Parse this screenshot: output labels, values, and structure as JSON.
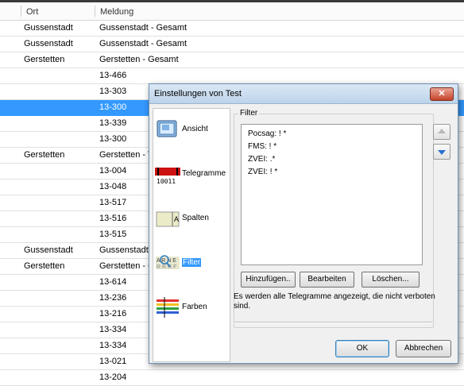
{
  "table": {
    "columns": {
      "ort": "Ort",
      "meldung": "Meldung"
    },
    "rows": [
      {
        "ort": "Gussenstadt",
        "meldung": "Gussenstadt - Gesamt"
      },
      {
        "ort": "Gussenstadt",
        "meldung": "Gussenstadt - Gesamt"
      },
      {
        "ort": "Gerstetten",
        "meldung": "Gerstetten - Gesamt"
      },
      {
        "ort": "",
        "meldung": "13-466"
      },
      {
        "ort": "",
        "meldung": "13-303"
      },
      {
        "ort": "",
        "meldung": "13-300",
        "selected": true
      },
      {
        "ort": "",
        "meldung": "13-339"
      },
      {
        "ort": "",
        "meldung": "13-300"
      },
      {
        "ort": "Gerstetten",
        "meldung": "Gerstetten - T"
      },
      {
        "ort": "",
        "meldung": "13-004"
      },
      {
        "ort": "",
        "meldung": "13-048"
      },
      {
        "ort": "",
        "meldung": "13-517"
      },
      {
        "ort": "",
        "meldung": "13-516"
      },
      {
        "ort": "",
        "meldung": "13-515"
      },
      {
        "ort": "Gussenstadt",
        "meldung": "Gussenstadt -"
      },
      {
        "ort": "Gerstetten",
        "meldung": "Gerstetten - G"
      },
      {
        "ort": "",
        "meldung": "13-614"
      },
      {
        "ort": "",
        "meldung": "13-236"
      },
      {
        "ort": "",
        "meldung": "13-216"
      },
      {
        "ort": "",
        "meldung": "13-334"
      },
      {
        "ort": "",
        "meldung": "13-334"
      },
      {
        "ort": "",
        "meldung": "13-021"
      },
      {
        "ort": "",
        "meldung": "13-204"
      }
    ]
  },
  "dialog": {
    "title": "Einstellungen von Test",
    "close_label": "✕",
    "nav": [
      {
        "label": "Ansicht",
        "icon": "monitor-icon"
      },
      {
        "label": "Telegramme",
        "icon": "telegram-icon"
      },
      {
        "label": "Spalten",
        "icon": "columns-icon"
      },
      {
        "label": "Filter",
        "icon": "filter-icon",
        "active": true
      },
      {
        "label": "Farben",
        "icon": "colors-icon"
      }
    ],
    "filter": {
      "legend": "Filter",
      "items": [
        "Pocsag: ! *",
        "FMS: ! *",
        "ZVEI: .*",
        "ZVEI: ! *"
      ],
      "add_label": "Hinzufügen..",
      "edit_label": "Bearbeiten",
      "delete_label": "Löschen...",
      "info": "Es werden alle Telegramme angezeigt, die nicht verboten sind."
    },
    "ok_label": "OK",
    "cancel_label": "Abbrechen"
  },
  "colors": {
    "selection": "#3399ff",
    "close": "#c7432b"
  }
}
